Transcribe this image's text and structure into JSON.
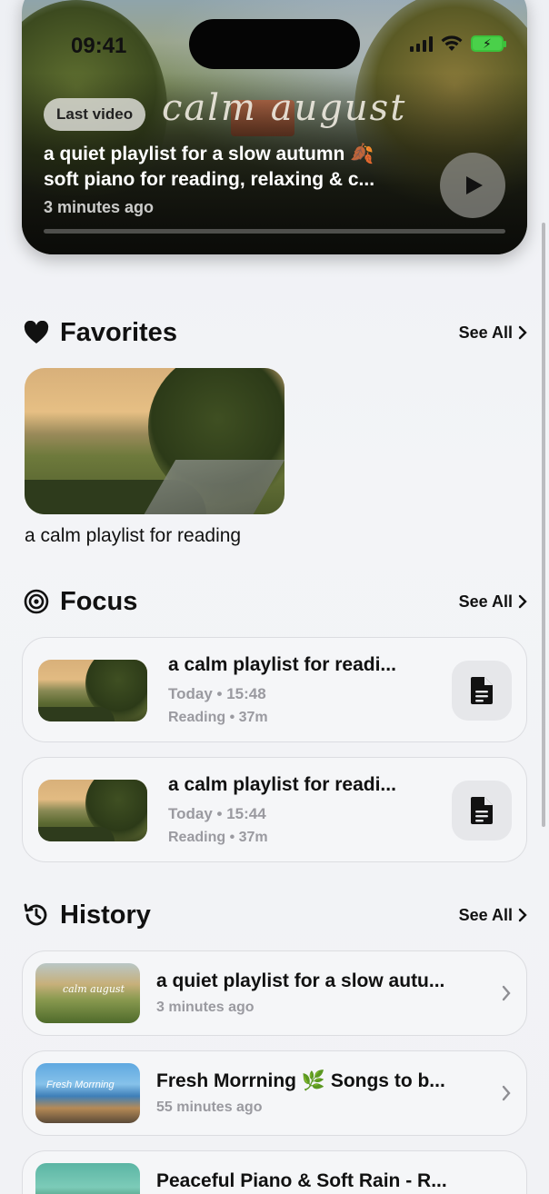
{
  "status_bar": {
    "time": "09:41"
  },
  "hero": {
    "badge": "Last video",
    "artwork_text": "calm  august",
    "title_line1": "a quiet playlist for a slow autumn 🍂",
    "title_line2": "soft piano for reading, relaxing & c...",
    "time_ago": "3 minutes ago",
    "progress_fraction": 0.0,
    "play_icon": "play-icon"
  },
  "favorites": {
    "icon": "heart-icon",
    "title": "Favorites",
    "see_all": "See All",
    "items": [
      {
        "label": "a calm playlist for reading"
      }
    ]
  },
  "focus": {
    "icon": "target-icon",
    "title": "Focus",
    "see_all": "See All",
    "items": [
      {
        "title": "a calm playlist for readi...",
        "meta1": "Today • 15:48",
        "meta2": "Reading • 37m",
        "action_icon": "document-icon"
      },
      {
        "title": "a calm playlist for readi...",
        "meta1": "Today • 15:44",
        "meta2": "Reading • 37m",
        "action_icon": "document-icon"
      }
    ]
  },
  "history": {
    "icon": "history-icon",
    "title": "History",
    "see_all": "See All",
    "items": [
      {
        "title": "a quiet playlist for a slow autu...",
        "meta": "3 minutes ago",
        "thumb_text": "calm  august"
      },
      {
        "title": "Fresh Morrning 🌿 Songs to b...",
        "meta": "55 minutes ago",
        "thumb_text": "Fresh Morrning"
      },
      {
        "title": "Peaceful Piano & Soft Rain - R...",
        "meta": "",
        "thumb_text": ""
      }
    ]
  }
}
